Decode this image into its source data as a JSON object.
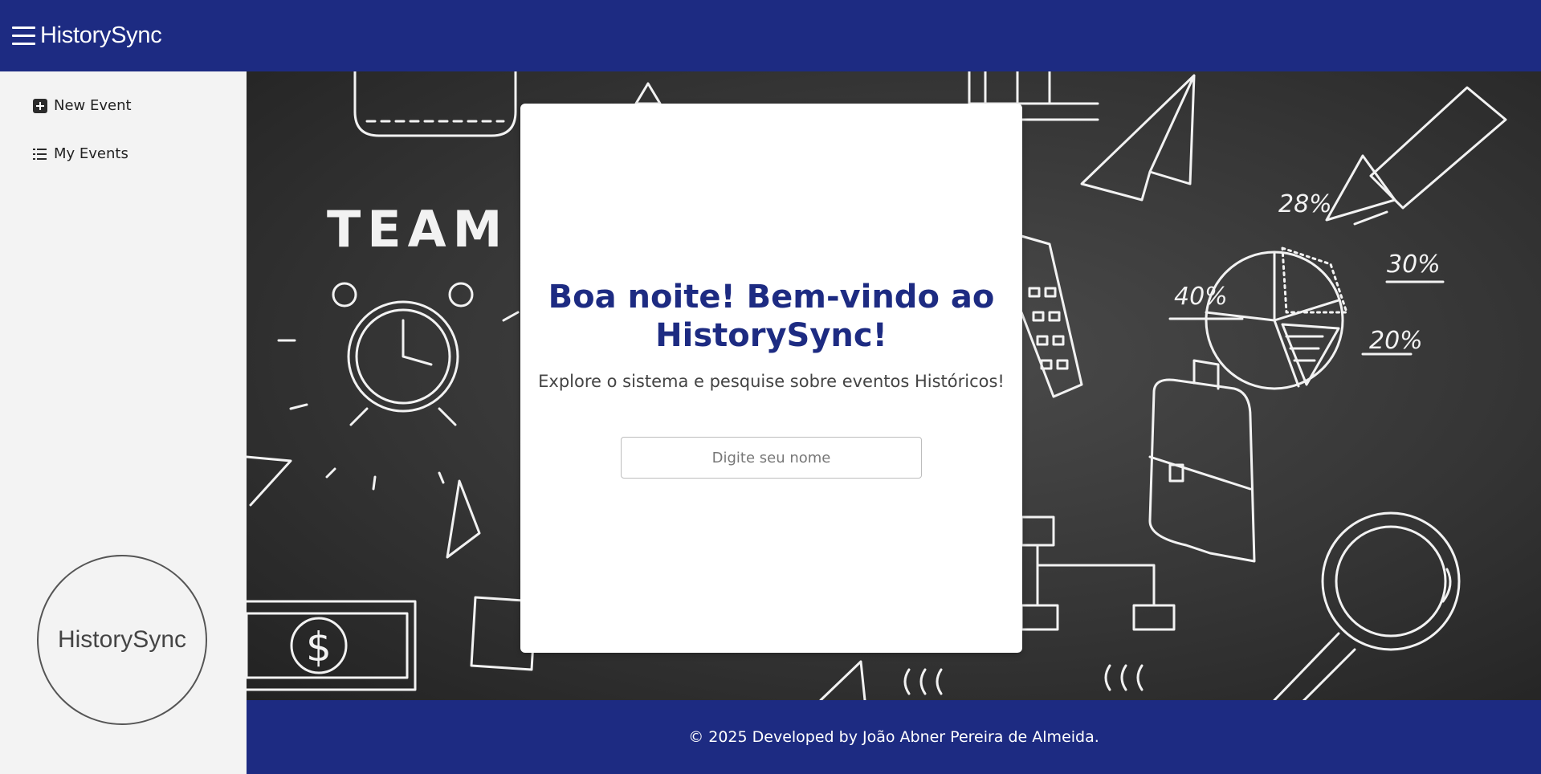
{
  "header": {
    "menu_icon": "hamburger-menu-icon",
    "brand": "HistorySync"
  },
  "sidebar": {
    "items": [
      {
        "label": "New Event",
        "icon": "plus-square-icon"
      },
      {
        "label": "My Events",
        "icon": "list-icon"
      }
    ],
    "logo_text": "HistorySync"
  },
  "main": {
    "background": "chalkboard-doodles",
    "doodle_labels": {
      "team": "TEAM",
      "pie_28": "28%",
      "pie_30": "30%",
      "pie_40": "40%",
      "pie_20": "20%",
      "dollar": "$"
    },
    "card": {
      "greeting": "Boa noite! Bem-vindo ao HistorySync!",
      "subtitle": "Explore o sistema e pesquise sobre eventos Históricos!",
      "name_input": {
        "placeholder": "Digite seu nome",
        "value": ""
      }
    }
  },
  "footer": {
    "text": "© 2025 Developed by João Abner Pereira de Almeida."
  },
  "colors": {
    "primary": "#1d2b82",
    "sidebar_bg": "#f3f3f3",
    "chalkboard": "#3a3a3a"
  }
}
